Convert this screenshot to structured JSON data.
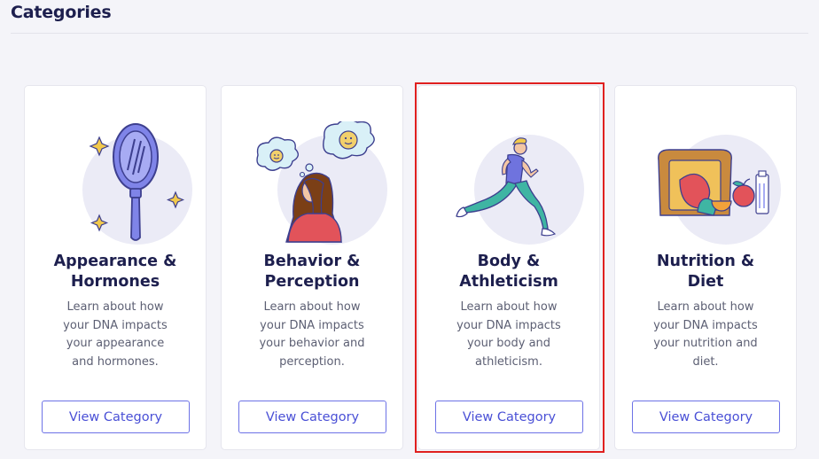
{
  "page": {
    "title": "Categories"
  },
  "cards": [
    {
      "title_line1": "Appearance &",
      "title_line2": "Hormones",
      "description": "Learn about how your DNA impacts your appearance and hormones.",
      "button_label": "View Category",
      "illustration": "hand-mirror-icon"
    },
    {
      "title_line1": "Behavior &",
      "title_line2": "Perception",
      "description": "Learn about how your DNA impacts your behavior and perception.",
      "button_label": "View Category",
      "illustration": "thinking-person-icon"
    },
    {
      "title_line1": "Body &",
      "title_line2": "Athleticism",
      "description": "Learn about how your DNA impacts your body and athleticism.",
      "button_label": "View Category",
      "illustration": "runner-icon"
    },
    {
      "title_line1": "Nutrition &",
      "title_line2": "Diet",
      "description": "Learn about how your DNA impacts your nutrition and diet.",
      "button_label": "View Category",
      "illustration": "food-icon"
    }
  ],
  "colors": {
    "accent": "#4a50d6",
    "heading": "#1d1f4e",
    "highlight": "#e0201f",
    "background": "#f4f4f9"
  }
}
